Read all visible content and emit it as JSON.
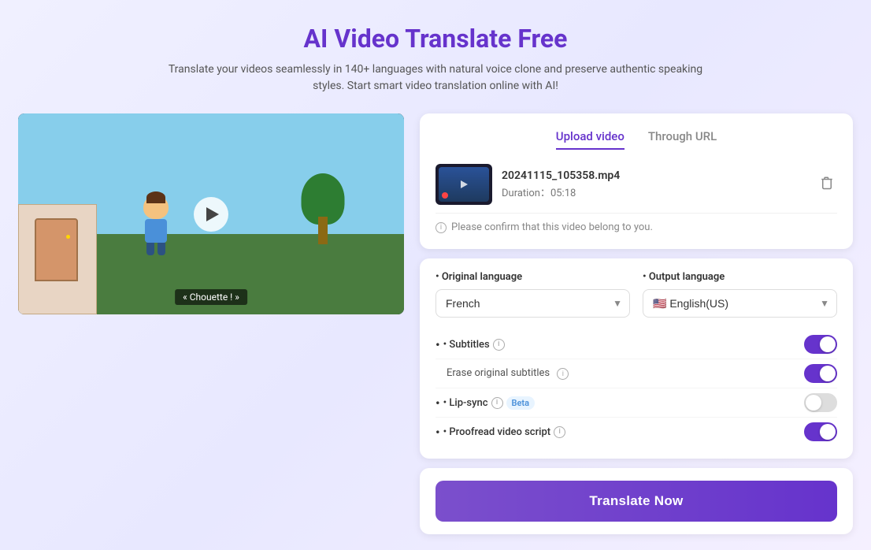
{
  "header": {
    "title": "AI Video Translate Free",
    "subtitle": "Translate your videos seamlessly in 140+ languages with natural voice clone and preserve authentic speaking styles. Start smart video translation online with AI!"
  },
  "tabs": {
    "upload": "Upload video",
    "url": "Through URL"
  },
  "file": {
    "name": "20241115_105358.mp4",
    "duration_label": "Duration：",
    "duration_value": "05:18",
    "confirm_text": "Please confirm that this video belong to you."
  },
  "languages": {
    "original_label": "• Original language",
    "output_label": "• Output language",
    "original_value": "French",
    "output_value": "English(US)",
    "flag": "🇺🇸"
  },
  "settings": {
    "subtitles_label": "• Subtitles",
    "erase_label": "Erase original subtitles",
    "lipsync_label": "• Lip-sync",
    "beta_label": "Beta",
    "proofread_label": "• Proofread video script",
    "subtitles_on": true,
    "erase_on": true,
    "lipsync_on": false,
    "proofread_on": true
  },
  "video": {
    "caption": "« Chouette ! »"
  },
  "cta": {
    "button_label": "Translate Now"
  }
}
